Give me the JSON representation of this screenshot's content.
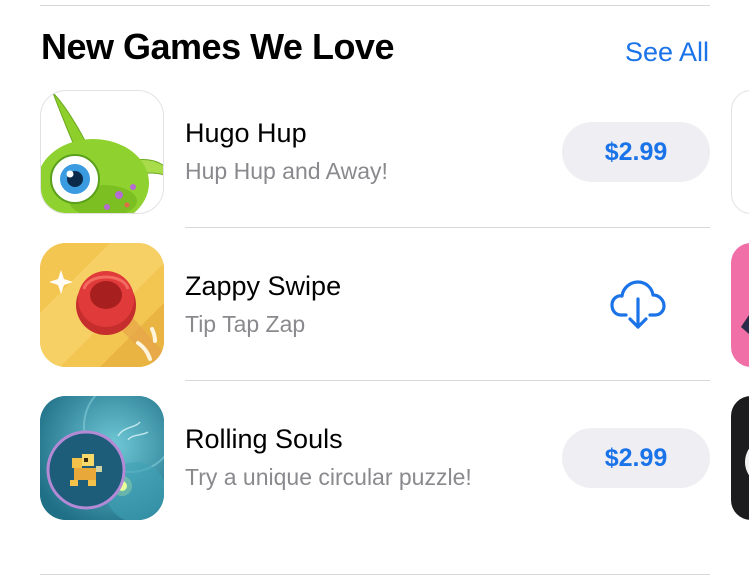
{
  "section": {
    "title": "New Games We Love",
    "see_all_label": "See All"
  },
  "apps": [
    {
      "name": "Hugo Hup",
      "subtitle": "Hup Hup and Away!",
      "action": "price",
      "price": "$2.99",
      "icon": "hugo-hup-app-icon"
    },
    {
      "name": "Zappy Swipe",
      "subtitle": "Tip Tap Zap",
      "action": "download",
      "icon": "zappy-swipe-app-icon",
      "action_icon": "cloud-download-icon"
    },
    {
      "name": "Rolling Souls",
      "subtitle": "Try a unique circular puzzle!",
      "action": "price",
      "price": "$2.99",
      "icon": "rolling-souls-app-icon"
    }
  ],
  "colors": {
    "accent": "#1a73e8",
    "button_bg": "#eeeef3",
    "subtitle": "#8a8a8e",
    "divider": "#d8d8dc"
  }
}
